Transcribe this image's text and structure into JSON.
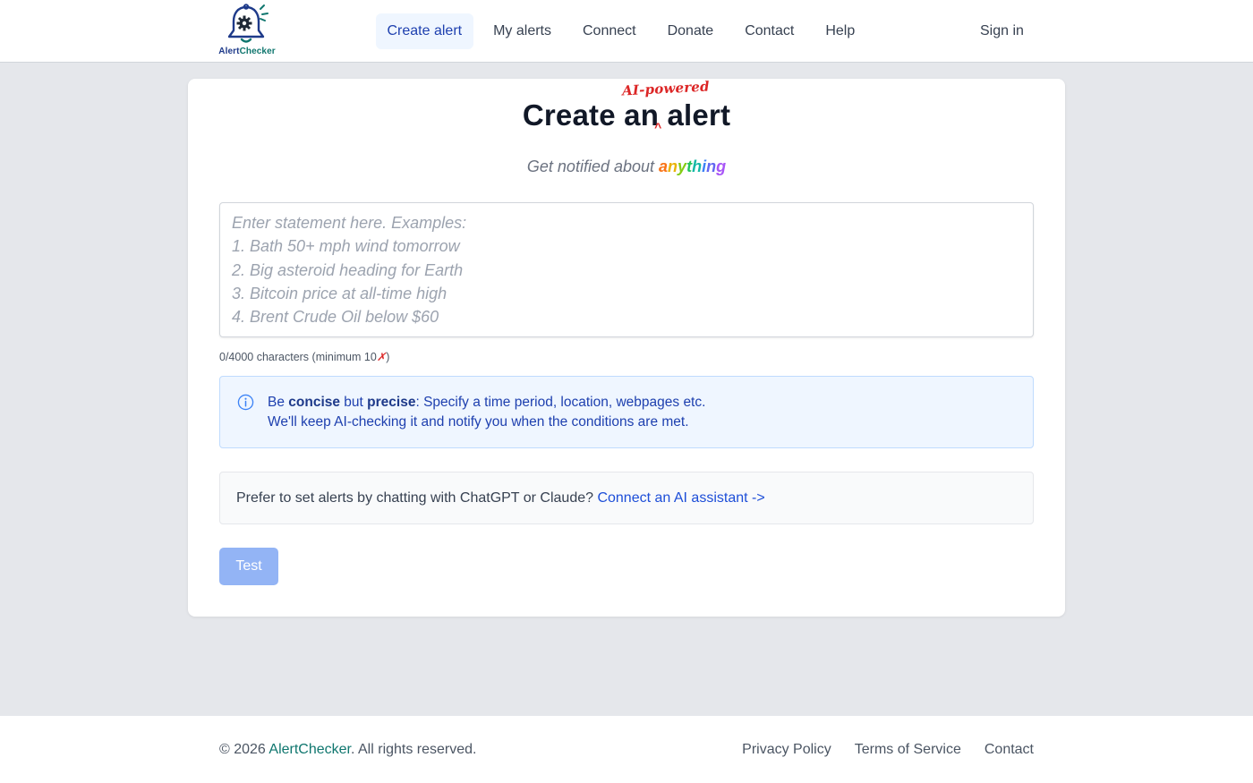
{
  "header": {
    "logo_text_part1": "Alert",
    "logo_text_part2": "Checker",
    "nav": [
      {
        "label": "Create alert",
        "active": true
      },
      {
        "label": "My alerts"
      },
      {
        "label": "Connect"
      },
      {
        "label": "Donate"
      },
      {
        "label": "Contact"
      },
      {
        "label": "Help"
      }
    ],
    "sign_in": "Sign in"
  },
  "main": {
    "title_part1": "Create",
    "title_an": "an",
    "title_part2": "alert",
    "title_annotation": "AI-powered",
    "title_caret": "^",
    "subtitle_prefix": "Get notified about",
    "subtitle_highlight": "anything",
    "rainbow_colors": [
      "#f97316",
      "#eab308",
      "#84cc16",
      "#22c55e",
      "#14b8a6",
      "#3b82f6",
      "#6366f1",
      "#a855f7"
    ],
    "statement_placeholder": "Enter statement here. Examples:\n1. Bath 50+ mph wind tomorrow\n2. Big asteroid heading for Earth\n3. Bitcoin price at all-time high\n4. Brent Crude Oil below $60",
    "statement_value": "",
    "char_count": "0/4000 characters (minimum 10",
    "char_count_mark": "✗",
    "char_count_close": ")",
    "info": {
      "be": "Be ",
      "concise": "concise",
      "but": " but ",
      "precise": "precise",
      "rest": ": Specify a time period, location, webpages etc.",
      "line2": "We'll keep AI-checking it and notify you when the conditions are met."
    },
    "prefer_text": "Prefer to set alerts by chatting with ChatGPT or Claude? ",
    "prefer_link": "Connect an AI assistant ->",
    "test_button": "Test"
  },
  "footer": {
    "copyright_prefix": "© 2026 ",
    "brand_part1": "Alert",
    "brand_part2": "Checker",
    "copyright_suffix": ". All rights reserved.",
    "links": [
      "Privacy Policy",
      "Terms of Service",
      "Contact"
    ]
  },
  "colors": {
    "primary": "#1e40af",
    "brand_teal": "#0f766e",
    "accent_red": "#dc2626",
    "test_button": "#93b4f5"
  }
}
